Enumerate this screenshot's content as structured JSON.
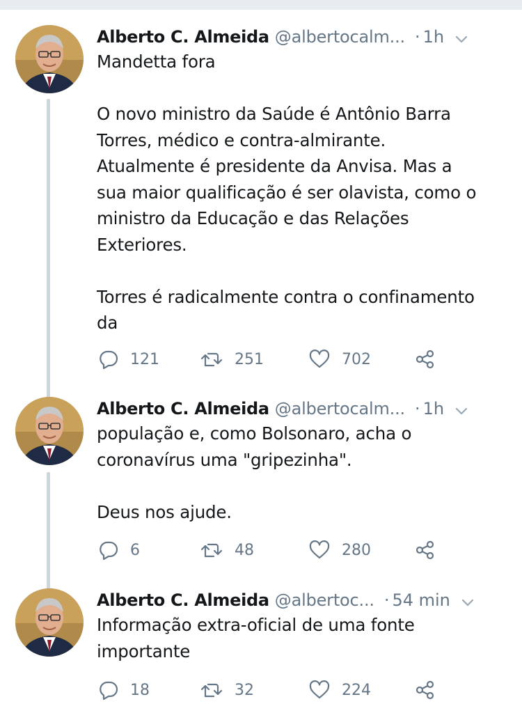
{
  "tweets": [
    {
      "author": "Alberto C. Almeida",
      "handle": "@albertocalm...",
      "dot": "·",
      "time": "1h",
      "lines": [
        "Mandetta fora",
        "",
        "O novo ministro da Saúde é Antônio Barra",
        "Torres, médico e contra-almirante.",
        "Atualmente é presidente da Anvisa. Mas a",
        "sua maior qualificação é ser olavista, como o",
        "ministro da Educação e das Relações",
        "Exteriores.",
        "",
        "Torres é radicalmente contra o confinamento",
        "da"
      ],
      "replies": "121",
      "retweets": "251",
      "likes": "702"
    },
    {
      "author": "Alberto C. Almeida",
      "handle": "@albertocalm...",
      "dot": "·",
      "time": "1h",
      "lines": [
        "população e, como Bolsonaro, acha o",
        "coronavírus uma \"gripezinha\".",
        "",
        "Deus nos ajude."
      ],
      "replies": "6",
      "retweets": "48",
      "likes": "280"
    },
    {
      "author": "Alberto C. Almeida",
      "handle": "@albertoc...",
      "dot": "·",
      "time": "54 min",
      "lines": [
        "Informação extra-oficial de uma fonte",
        "importante"
      ],
      "replies": "18",
      "retweets": "32",
      "likes": "224"
    }
  ],
  "icons": {
    "reply": "reply-icon",
    "retweet": "retweet-icon",
    "like": "heart-icon",
    "share": "share-icon",
    "menu": "chevron-down-icon"
  },
  "colors": {
    "text": "#14171a",
    "secondary": "#657786",
    "thread_line": "#ccd6dd",
    "top_bar": "#e6ecf0"
  }
}
